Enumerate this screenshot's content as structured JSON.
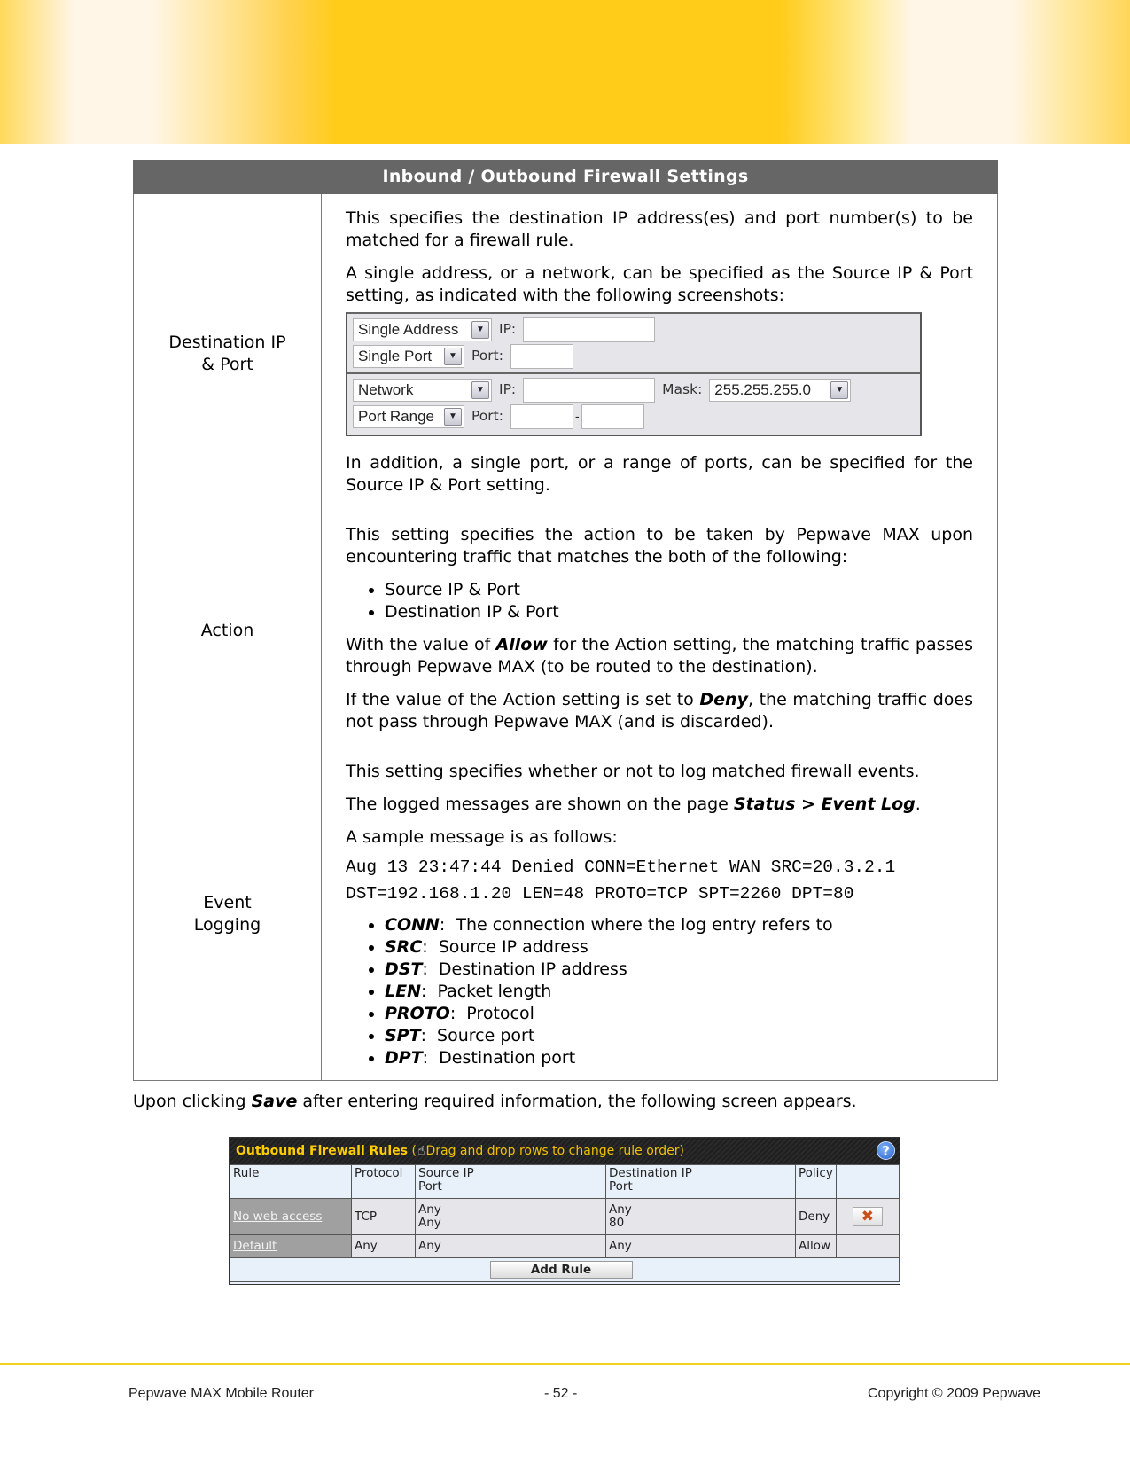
{
  "table": {
    "title": "Inbound /  Outbound Firewall Settings",
    "rows": {
      "destination": {
        "label_line1": "Destination IP",
        "label_line2": "& Port",
        "p1": "This specifies the destination IP address(es) and port number(s) to be matched for a firewall rule.",
        "p2": "A single address, or a network, can be specified as the Source IP & Port setting, as indicated with the following screenshots:",
        "p3": "In addition, a single port, or a range of ports, can be specified for the Source IP & Port setting.",
        "form_shot": {
          "row1": {
            "select": "Single Address",
            "label": "IP:",
            "value": ""
          },
          "row2": {
            "select": "Single Port",
            "label": "Port:",
            "value": ""
          },
          "row3": {
            "select": "Network",
            "label": "IP:",
            "value": "",
            "mask_label": "Mask:",
            "mask_value": "255.255.255.0"
          },
          "row4": {
            "select": "Port Range",
            "label": "Port:",
            "from": "",
            "separator": "-",
            "to": ""
          }
        }
      },
      "action": {
        "label": "Action",
        "p1": "This setting specifies the action to be taken by Pepwave MAX upon encountering traffic that matches the both of the following:",
        "bullets": [
          "Source IP & Port",
          "Destination IP & Port"
        ],
        "p2_pre": "With the value of ",
        "p2_bold": "Allow",
        "p2_post": " for the Action setting, the matching traffic passes through Pepwave MAX (to be routed to the destination).",
        "p3_pre": "If the value of the Action setting is set to ",
        "p3_bold": "Deny",
        "p3_post": ", the matching traffic does not pass through Pepwave MAX (and is discarded)."
      },
      "event_logging": {
        "label_line1": "Event",
        "label_line2": "Logging",
        "p1": "This setting specifies whether or not to log matched firewall events.",
        "p2_pre": "The logged messages are shown on the page ",
        "p2_bold": "Status > Event Log",
        "p2_post": ".",
        "p3": "A sample message is as follows:",
        "sample_line1": "Aug 13 23:47:44 Denied CONN=Ethernet WAN SRC=20.3.2.1",
        "sample_line2": "DST=192.168.1.20 LEN=48 PROTO=TCP SPT=2260 DPT=80",
        "fields": [
          {
            "key": "CONN",
            "desc": ":  The connection where the log entry refers to"
          },
          {
            "key": "SRC",
            "desc": ":  Source IP address"
          },
          {
            "key": "DST",
            "desc": ":  Destination IP address"
          },
          {
            "key": "LEN",
            "desc": ":  Packet length"
          },
          {
            "key": "PROTO",
            "desc": ":  Protocol"
          },
          {
            "key": "SPT",
            "desc": ":  Source port"
          },
          {
            "key": "DPT",
            "desc": ":  Destination port"
          }
        ]
      }
    }
  },
  "after_text": {
    "pre": "Upon clicking ",
    "bold": "Save",
    "post": " after entering required information, the following screen appears."
  },
  "rules_shot": {
    "title": "Outbound Firewall Rules",
    "subtitle_open": " (",
    "subtitle": "Drag and drop rows to change rule order)",
    "hand_icon": "☝",
    "help_icon": "?",
    "headers": {
      "rule": "Rule",
      "protocol": "Protocol",
      "source_1": "Source IP",
      "source_2": "Port",
      "dest_1": "Destination IP",
      "dest_2": "Port",
      "policy": "Policy"
    },
    "rows": [
      {
        "rule": "No web access",
        "protocol": "TCP",
        "source_ip": "Any",
        "source_port": "Any",
        "dest_ip": "Any",
        "dest_port": "80",
        "policy": "Deny",
        "delete": "✖"
      },
      {
        "rule": "Default",
        "protocol": "Any",
        "source": "Any",
        "dest": "Any",
        "policy": "Allow"
      }
    ],
    "add_button": "Add Rule"
  },
  "footer": {
    "left": "Pepwave MAX Mobile Router",
    "center": "- 52 -",
    "right": "Copyright © 2009 Pepwave"
  },
  "colors": {
    "banner_yellow": "#ffcc1a",
    "table_header": "#666666",
    "footer_line": "#f4d21c",
    "rules_title_text": "#ffcc00"
  }
}
